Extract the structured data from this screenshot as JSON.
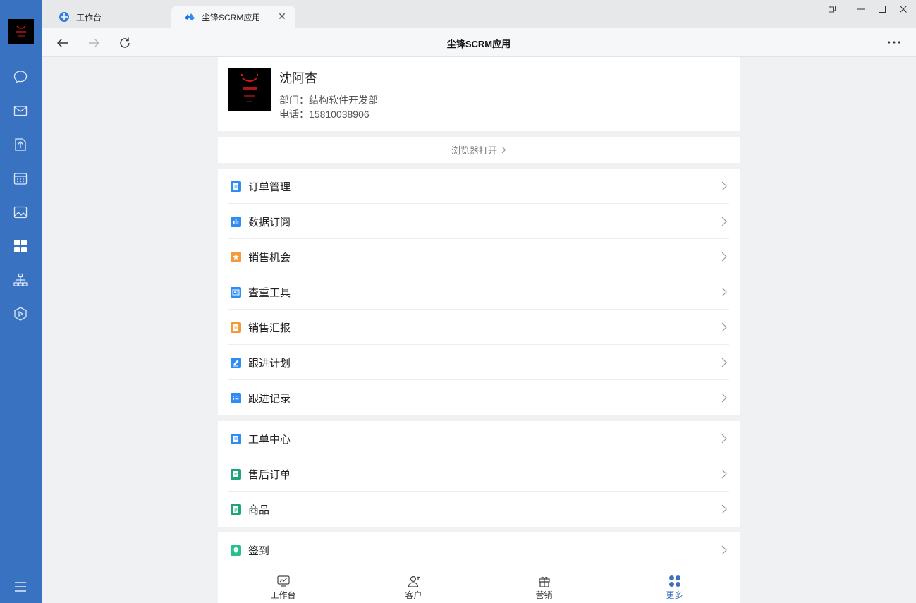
{
  "rail": {
    "items": [
      "chat-icon",
      "mail-icon",
      "doc-icon",
      "calendar-icon",
      "image-icon",
      "apps-icon",
      "org-icon",
      "hex-icon",
      "menu-icon"
    ]
  },
  "tabs": [
    {
      "label": "工作台",
      "active": false
    },
    {
      "label": "尘锋SCRM应用",
      "active": true
    }
  ],
  "navbar": {
    "title": "尘锋SCRM应用"
  },
  "profile": {
    "name": "沈阿杏",
    "department": "部门：结构软件开发部",
    "phone": "电话：15810038906"
  },
  "browser_open": {
    "label": "浏览器打开"
  },
  "menu_groups": [
    [
      {
        "label": "订单管理",
        "icon": "order-icon",
        "color": "#2f8cf5"
      },
      {
        "label": "数据订阅",
        "icon": "chart-icon",
        "color": "#2f8cf5"
      },
      {
        "label": "销售机会",
        "icon": "star-icon",
        "color": "#f59a3a"
      },
      {
        "label": "查重工具",
        "icon": "search-card-icon",
        "color": "#2f8cf5"
      },
      {
        "label": "销售汇报",
        "icon": "report-icon",
        "color": "#f59a3a"
      },
      {
        "label": "跟进计划",
        "icon": "edit-icon",
        "color": "#2f8cf5"
      },
      {
        "label": "跟进记录",
        "icon": "list-icon",
        "color": "#2f8cf5"
      }
    ],
    [
      {
        "label": "工单中心",
        "icon": "ticket-icon",
        "color": "#2f8cf5"
      },
      {
        "label": "售后订单",
        "icon": "aftersale-icon",
        "color": "#1fa37a"
      },
      {
        "label": "商品",
        "icon": "product-icon",
        "color": "#1fa37a"
      }
    ],
    [
      {
        "label": "签到",
        "icon": "location-icon",
        "color": "#28c18c"
      }
    ]
  ],
  "bottom_tabs": [
    {
      "label": "工作台",
      "icon": "dashboard-icon",
      "active": false
    },
    {
      "label": "客户",
      "icon": "customer-icon",
      "active": false
    },
    {
      "label": "营销",
      "icon": "gift-icon",
      "active": false
    },
    {
      "label": "更多",
      "icon": "grid-icon",
      "active": true
    }
  ],
  "colors": {
    "rail": "#3a72c2",
    "accent": "#2f8cf5",
    "active_tab_text": "#3a72c2"
  }
}
